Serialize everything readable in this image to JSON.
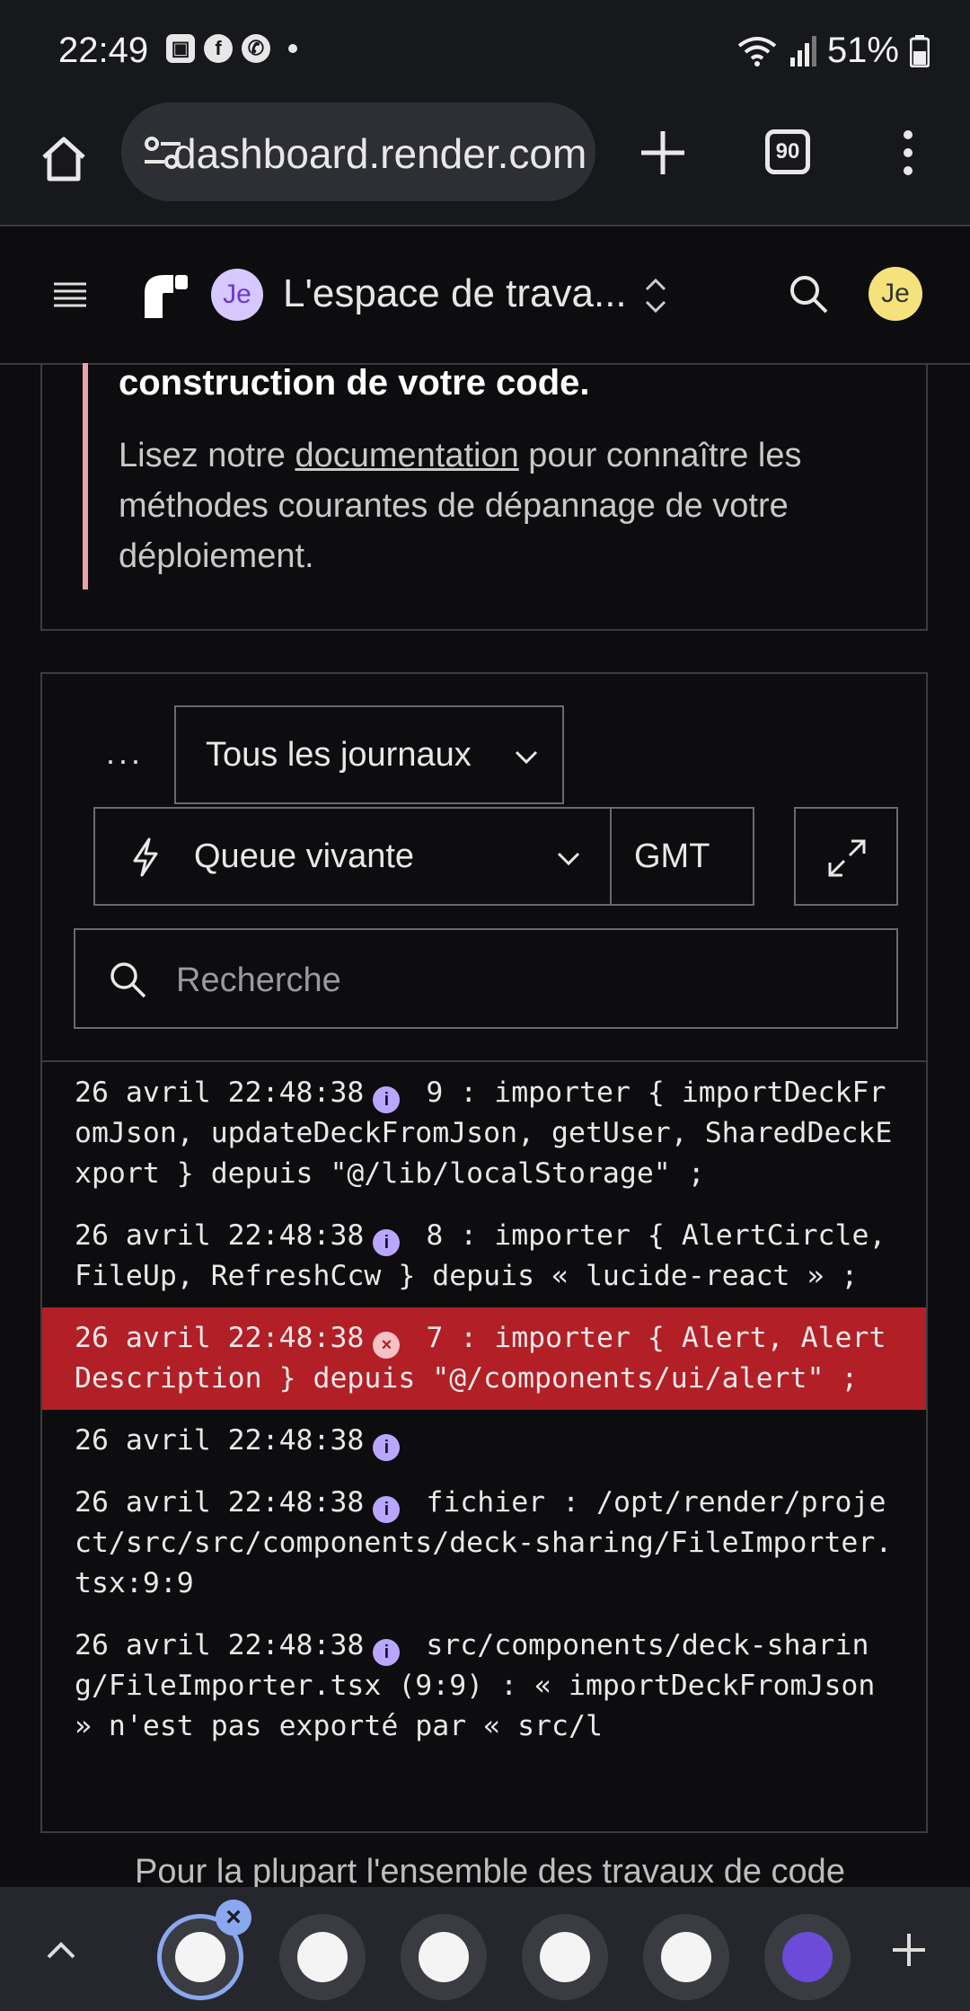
{
  "status_bar": {
    "time": "22:49",
    "battery": "51%",
    "notification_icons": [
      "gallery-icon",
      "facebook-icon",
      "whatsapp-icon"
    ]
  },
  "browser": {
    "url": "dashboard.render.com",
    "tab_count": "90"
  },
  "app_header": {
    "workspace_avatar": "Je",
    "workspace_name": "L'espace de trava...",
    "user_avatar": "Je"
  },
  "callout": {
    "title": "construction de votre code.",
    "body_before": "Lisez notre ",
    "body_link": "documentation",
    "body_after": " pour connaître les méthodes courantes de dépannage de votre déploiement."
  },
  "logs": {
    "more_label": "···",
    "filter_label": "Tous les journaux",
    "tail_label": "Queue vivante",
    "timezone": "GMT",
    "search_placeholder": "Recherche",
    "entries": [
      {
        "timestamp": "26 avril 22:48:38",
        "level": "info",
        "message": "9 : importer { importDeckFromJson, updateDeckFromJson, getUser, SharedDeckExport } depuis \"@/lib/localStorage\" ;"
      },
      {
        "timestamp": "26 avril 22:48:38",
        "level": "info",
        "message": "8 : importer { AlertCircle, FileUp, RefreshCcw } depuis « lucide-react » ;"
      },
      {
        "timestamp": "26 avril 22:48:38",
        "level": "error",
        "message": "7 : importer { Alert, AlertDescription } depuis \"@/components/ui/alert\" ;"
      },
      {
        "timestamp": "26 avril 22:48:38",
        "level": "info",
        "message": ""
      },
      {
        "timestamp": "26 avril 22:48:38",
        "level": "info",
        "message": "fichier : /opt/render/project/src/src/components/deck-sharing/FileImporter.tsx:9:9"
      },
      {
        "timestamp": "26 avril 22:48:38",
        "level": "info",
        "message": "src/components/deck-sharing/FileImporter.tsx (9:9) : « importDeckFromJson » n'est pas exporté par « src/l"
      }
    ]
  },
  "bottom_peek_text": "Pour la plupart l'ensemble des travaux de code",
  "dock": {
    "items": [
      "tab-1",
      "tab-2",
      "tab-3",
      "tab-4",
      "tab-5",
      "tab-6"
    ]
  }
}
